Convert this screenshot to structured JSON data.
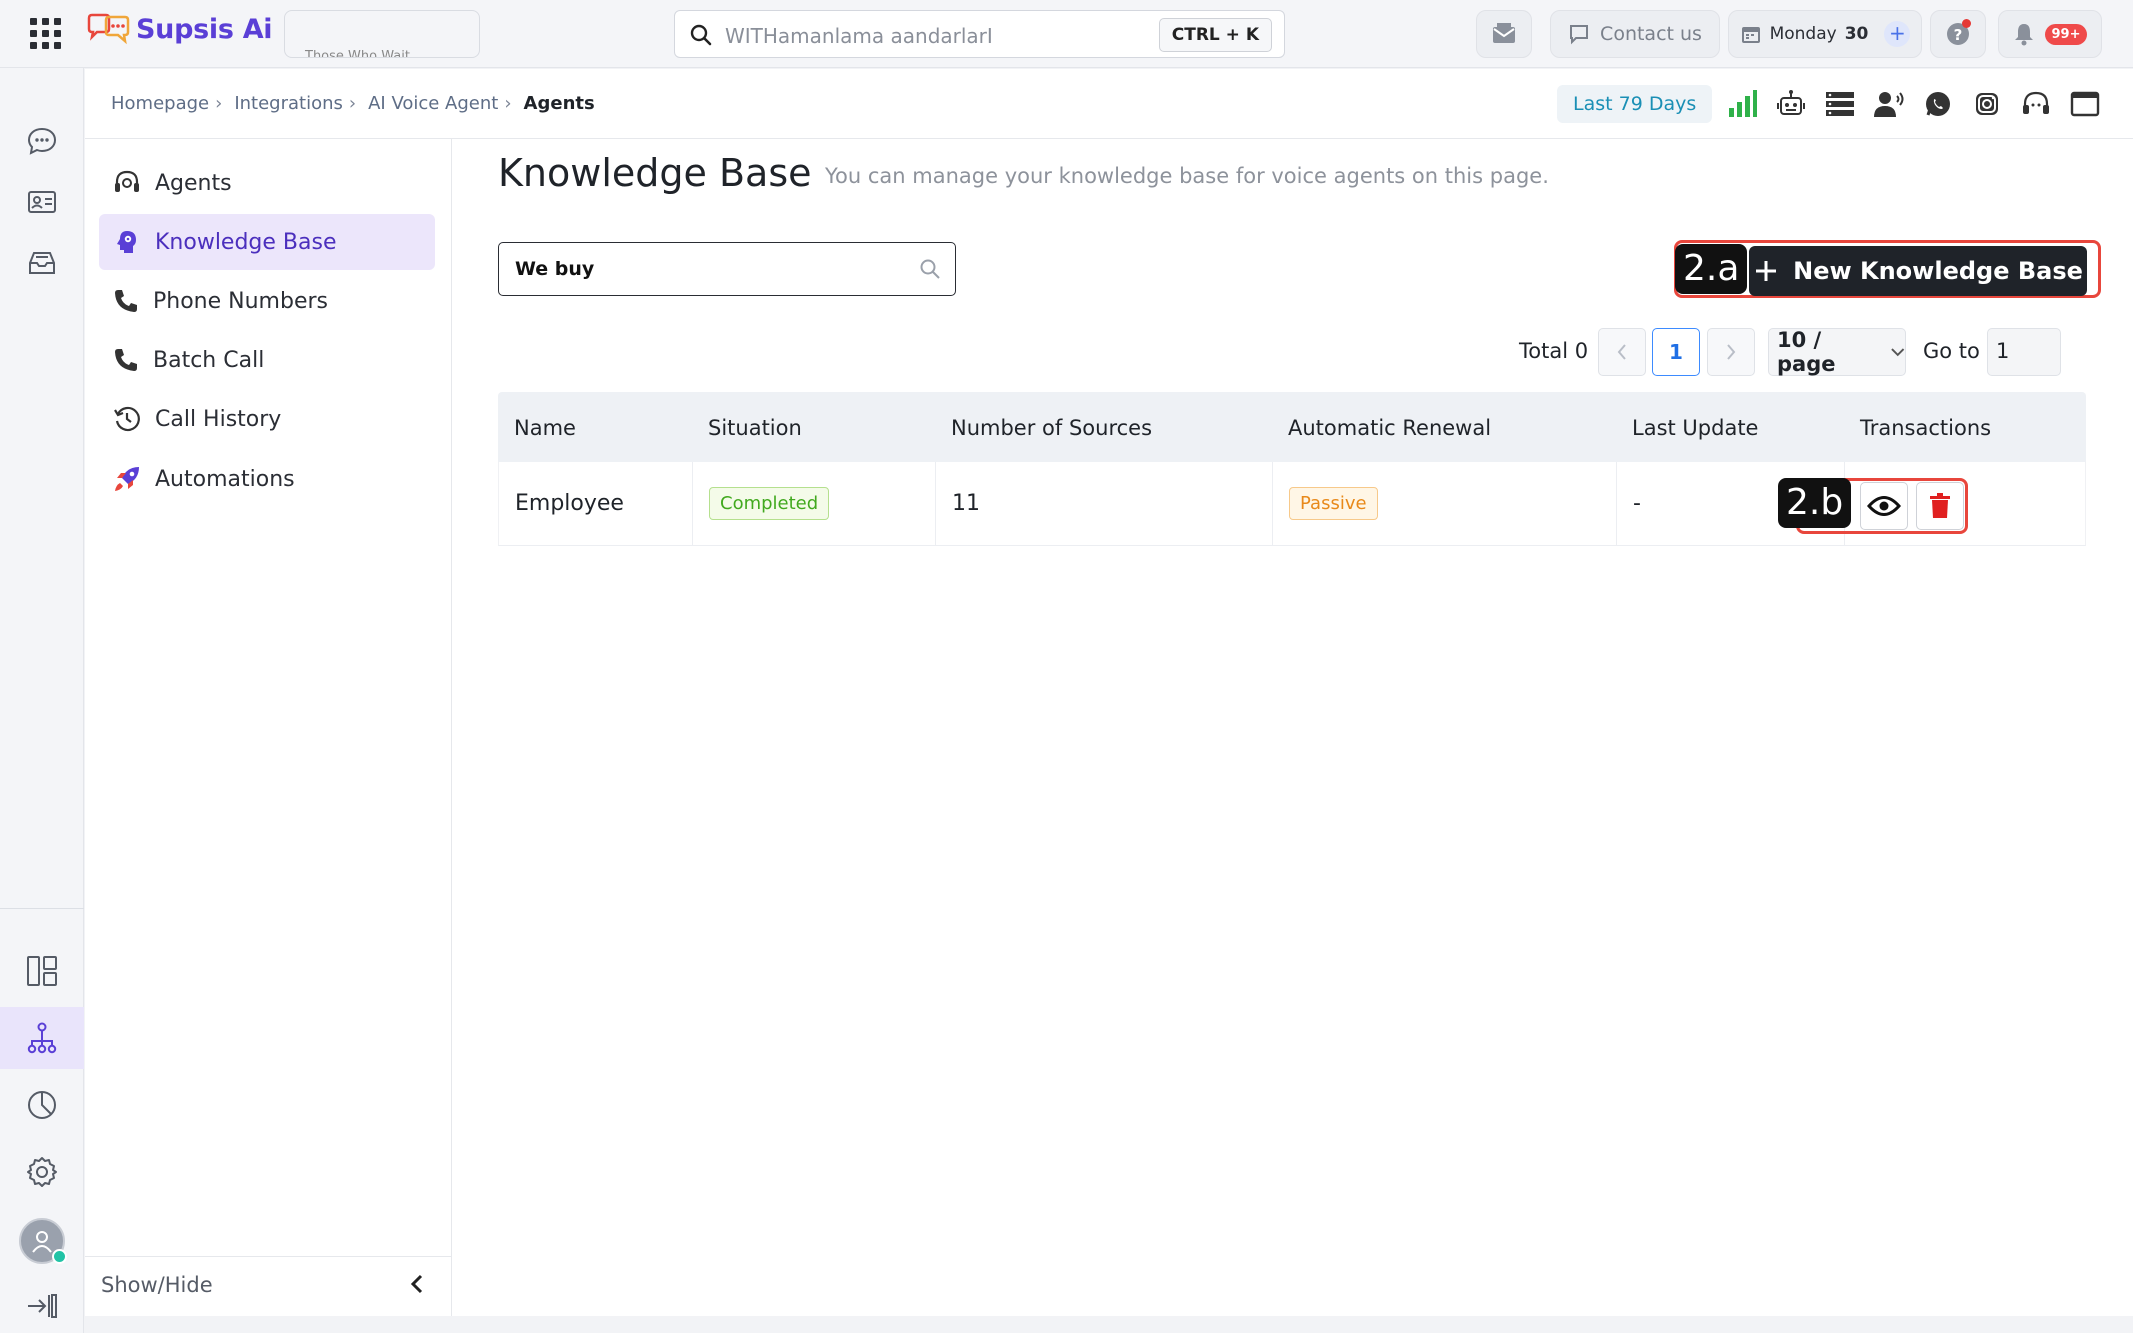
{
  "app": {
    "brand": "Supsis Ai",
    "tab_hint": "Those Who Wait",
    "search_placeholder": "WITHamanlama aandarlarI",
    "search_shortcut": "CTRL + K",
    "contact_label": "Contact us",
    "date_day": "Monday",
    "date_num": "30",
    "notification_count": "99+"
  },
  "breadcrumb": {
    "items": [
      "Homepage",
      "Integrations",
      "AI Voice Agent"
    ],
    "separator": "›",
    "current": "Agents"
  },
  "date_range": "Last 79 Days",
  "subnav": {
    "items": [
      {
        "label": "Agents",
        "icon": "headset-icon",
        "active": false
      },
      {
        "label": "Knowledge Base",
        "icon": "brain-icon",
        "active": true
      },
      {
        "label": "Phone Numbers",
        "icon": "phone-icon",
        "active": false
      },
      {
        "label": "Batch Call",
        "icon": "phone-icon",
        "active": false
      },
      {
        "label": "Call History",
        "icon": "history-icon",
        "active": false
      },
      {
        "label": "Automations",
        "icon": "rocket-icon",
        "active": false
      }
    ],
    "footer_label": "Show/Hide"
  },
  "page": {
    "title": "Knowledge Base",
    "subtitle": "You can manage your knowledge base for voice agents on this page.",
    "search_value": "We buy",
    "new_button": "New Knowledge Base",
    "step_a": "2.a",
    "step_b": "2.b"
  },
  "pagination": {
    "total_label": "Total 0",
    "current_page": "1",
    "page_size": "10 / page",
    "goto_label": "Go to",
    "goto_value": "1"
  },
  "table": {
    "columns": [
      "Name",
      "Situation",
      "Number of Sources",
      "Automatic Renewal",
      "Last Update",
      "Transactions"
    ],
    "rows": [
      {
        "name": "Employee",
        "situation": "Completed",
        "sources": "11",
        "renewal": "Passive",
        "last_update": "-"
      }
    ]
  },
  "colors": {
    "brand": "#5a3fd6",
    "accent_highlight": "#e8463c",
    "status_completed": "#42a91f",
    "status_passive": "#e8891a",
    "delete": "#e02020"
  }
}
